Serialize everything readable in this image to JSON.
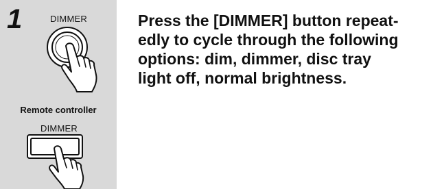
{
  "step": {
    "number": "1"
  },
  "illustration": {
    "top_label": "DIMMER",
    "remote_caption": "Remote controller",
    "bottom_label": "DIMMER",
    "top_icon": "round-button-press-icon",
    "bottom_icon": "rectangular-button-press-icon"
  },
  "instruction": {
    "lines": [
      "Press the [DIMMER] button repeat-",
      "edly to cycle through the following",
      "options: dim, dimmer, disc tray",
      "light off, normal brightness."
    ]
  },
  "colors": {
    "panel_background": "#d9d9d9",
    "text": "#111111"
  }
}
